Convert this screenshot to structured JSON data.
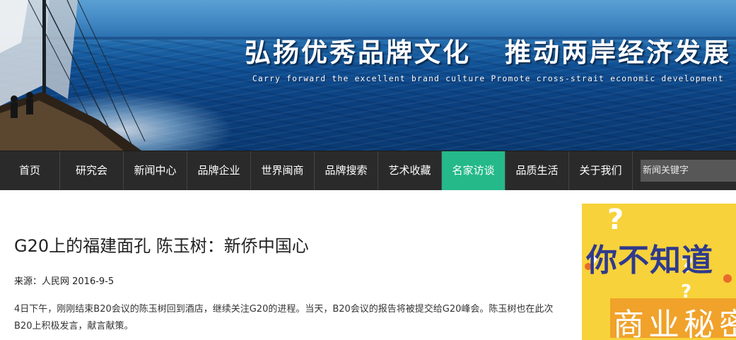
{
  "banner": {
    "title_left": "弘扬优秀品牌文化",
    "title_right": "推动两岸经济发展",
    "subtitle": "Carry forward the excellent brand culture Promote cross-strait economic development"
  },
  "nav": {
    "items": [
      {
        "label": "首页"
      },
      {
        "label": "研究会"
      },
      {
        "label": "新闻中心"
      },
      {
        "label": "品牌企业"
      },
      {
        "label": "世界闽商"
      },
      {
        "label": "品牌搜索"
      },
      {
        "label": "艺术收藏"
      },
      {
        "label": "名家访谈",
        "active": true
      },
      {
        "label": "品质生活"
      },
      {
        "label": "关于我们"
      }
    ],
    "search_placeholder": "新闻关键字",
    "active_color": "#25b889"
  },
  "article": {
    "title": "G20上的福建面孔 陈玉树：新侨中国心",
    "source": "来源：人民网 2016-9-5",
    "body": "4日下午，刚刚结束B20会议的陈玉树回到酒店，继续关注G20的进程。当天，B20会议的报告将被提交给G20峰会。陈玉树也在此次B20上积极发言，献言献策。"
  },
  "ad": {
    "line1": "你不知道",
    "line2": "商业秘密",
    "mark": "?"
  }
}
